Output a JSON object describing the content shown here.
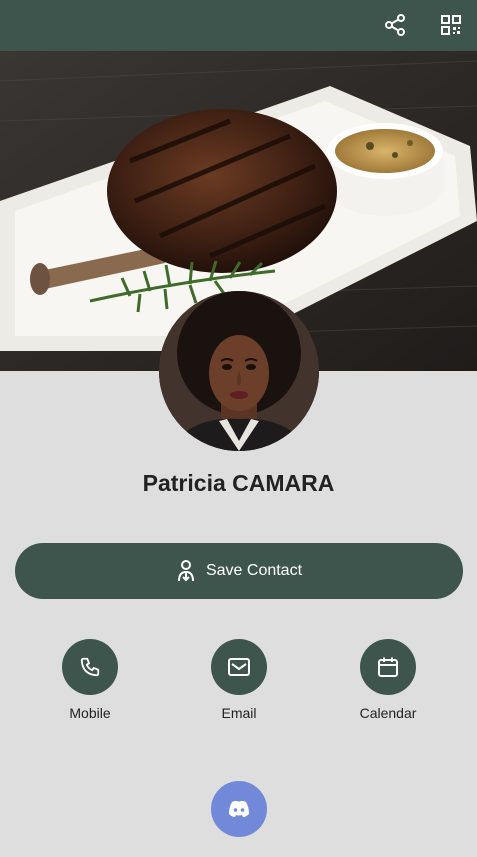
{
  "header": {
    "share_icon": "share-icon",
    "qr_icon": "qr-code-icon"
  },
  "profile": {
    "name": "Patricia CAMARA"
  },
  "save_contact": {
    "label": "Save Contact",
    "icon": "contact-download-icon"
  },
  "actions": [
    {
      "label": "Mobile",
      "icon": "phone-icon"
    },
    {
      "label": "Email",
      "icon": "envelope-icon"
    },
    {
      "label": "Calendar",
      "icon": "calendar-icon"
    }
  ],
  "social": {
    "icon": "discord-icon"
  },
  "colors": {
    "primary": "#3e554d",
    "background": "#dedede",
    "discord": "#7289da"
  }
}
